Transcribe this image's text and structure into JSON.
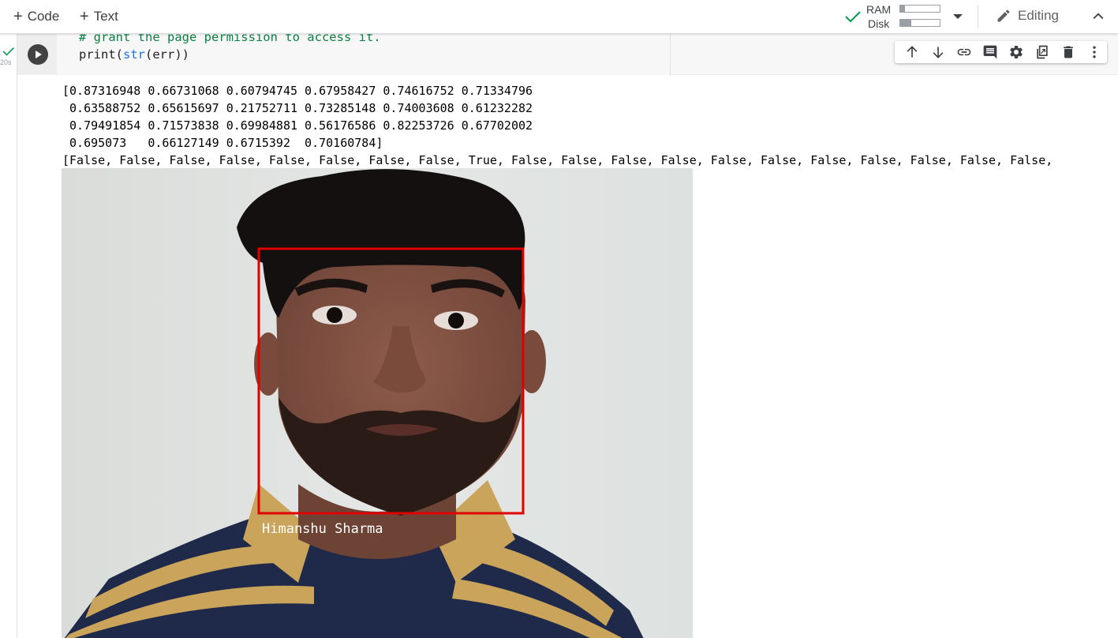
{
  "toolbar": {
    "code_button": "Code",
    "text_button": "Text",
    "ram_label": "RAM",
    "disk_label": "Disk",
    "ram_usage": 0.12,
    "disk_usage": 0.28,
    "editing_label": "Editing"
  },
  "cell": {
    "exec_time": "20s",
    "code_lines": [
      "# grant the page permission to access it.",
      "print(str(err))"
    ]
  },
  "output": {
    "lines": [
      "[0.87316948 0.66731068 0.60794745 0.67958427 0.74616752 0.71334796",
      " 0.63588752 0.65615697 0.21752711 0.73285148 0.74003608 0.61232282",
      " 0.79491854 0.71573838 0.69984881 0.56176586 0.82253726 0.67702002",
      " 0.695073   0.66127149 0.6715392  0.70160784]",
      "[False, False, False, False, False, False, False, False, True, False, False, False, False, False, False, False, False, False, False, False,"
    ],
    "face_label": "Himanshu Sharma",
    "box_color": "#e00000"
  },
  "icons": {
    "check": "check-icon",
    "run": "play-icon",
    "tools": [
      "arrow-up-icon",
      "arrow-down-icon",
      "link-icon",
      "comment-icon",
      "gear-icon",
      "mirror-cell-icon",
      "trash-icon",
      "more-vert-icon"
    ]
  }
}
